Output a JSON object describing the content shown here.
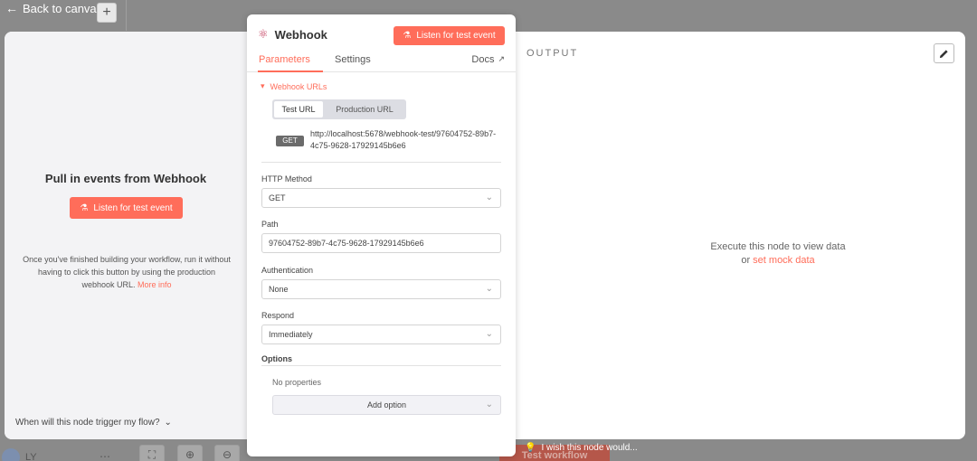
{
  "canvas": {
    "back_label": "Back to canvas",
    "user_initials": "LY",
    "wish_text": "I wish this node would...",
    "execute_ghost_label": "Test workflow"
  },
  "left": {
    "title": "Pull in events from Webhook",
    "listen_label": "Listen for test event",
    "description": "Once you've finished building your workflow, run it without having to click this button by using the production webhook URL.",
    "more_info": "More info",
    "trigger_question": "When will this node trigger my flow?"
  },
  "output": {
    "label": "OUTPUT",
    "execute_msg": "Execute this node to view data",
    "or_text": "or",
    "mock_link": "set mock data"
  },
  "panel": {
    "title": "Webhook",
    "listen_label": "Listen for test event",
    "tabs": [
      {
        "label": "Parameters",
        "active": true
      },
      {
        "label": "Settings",
        "active": false
      }
    ],
    "docs_label": "Docs",
    "webhook_urls_label": "Webhook URLs",
    "url_tabs": [
      "Test URL",
      "Production URL"
    ],
    "method_badge": "GET",
    "url": "http://localhost:5678/webhook-test/97604752-89b7-4c75-9628-17929145b6e6",
    "fields": {
      "http_method": {
        "label": "HTTP Method",
        "value": "GET"
      },
      "path": {
        "label": "Path",
        "value": "97604752-89b7-4c75-9628-17929145b6e6"
      },
      "authentication": {
        "label": "Authentication",
        "value": "None"
      },
      "respond": {
        "label": "Respond",
        "value": "Immediately"
      }
    },
    "options_label": "Options",
    "no_properties": "No properties",
    "add_option": "Add option"
  },
  "colors": {
    "accent": "#ff6d5a",
    "overlay": "#8a8a8a"
  }
}
